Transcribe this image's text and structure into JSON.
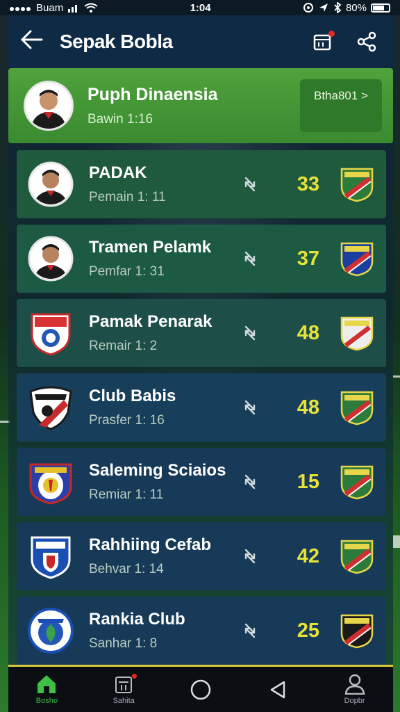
{
  "status_bar": {
    "carrier": "Buam",
    "time": "1:04",
    "battery": "80%"
  },
  "header": {
    "title": "Sepak Bobla"
  },
  "featured": {
    "name": "Puph Dinaensia",
    "subtitle": "Bawin 1:16",
    "button_label": "Btha801 >"
  },
  "rows": [
    {
      "name": "PADAK",
      "subtitle": "Pemain 1: 11",
      "score": "33",
      "row_color": "#1f5a3c",
      "crest": "player"
    },
    {
      "name": "Tramen Pelamk",
      "subtitle": "Pemfar 1: 31",
      "score": "37",
      "row_color": "#1d5a44",
      "crest": "player"
    },
    {
      "name": "Pamak Penarak",
      "subtitle": "Remair 1: 2",
      "score": "48",
      "row_color": "#1e4e48",
      "crest": "shield-red"
    },
    {
      "name": "Club Babis",
      "subtitle": "Prasfer 1: 16",
      "score": "48",
      "row_color": "#173e5a",
      "crest": "shield-stripe"
    },
    {
      "name": "Saleming Sciaios",
      "subtitle": "Remiar 1: 11",
      "score": "15",
      "row_color": "#163a58",
      "crest": "shield-blue"
    },
    {
      "name": "Rahhiing Cefab",
      "subtitle": "Behvar 1: 14",
      "score": "42",
      "row_color": "#163a58",
      "crest": "shield-navy"
    },
    {
      "name": "Rankia Club",
      "subtitle": "Sanhar 1: 8",
      "score": "25",
      "row_color": "#163a58",
      "crest": "round-leaf"
    }
  ],
  "nav": [
    {
      "label": "Bosho",
      "icon": "home-icon",
      "active": true
    },
    {
      "label": "Sahita",
      "icon": "team-icon",
      "active": false
    },
    {
      "label": "",
      "icon": "circle-icon",
      "active": false
    },
    {
      "label": "",
      "icon": "back-triangle-icon",
      "active": false
    },
    {
      "label": "Dopbr",
      "icon": "profile-icon",
      "active": false
    }
  ],
  "colors": {
    "accent_green": "#3fbf43",
    "score_yellow": "#e6e23a",
    "header_bg": "#0f2a44"
  }
}
